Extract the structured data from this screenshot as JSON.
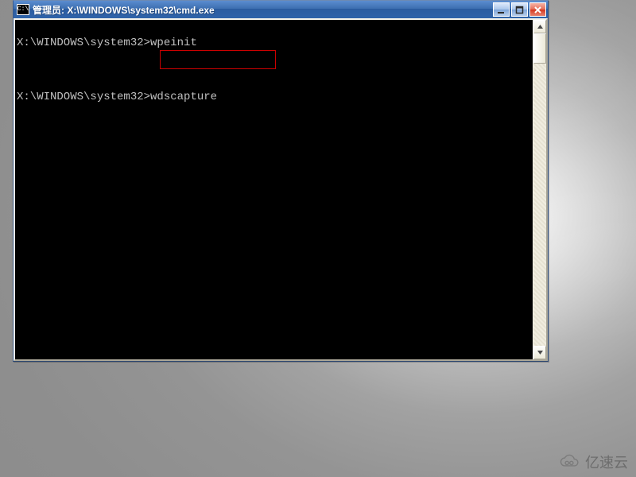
{
  "window": {
    "title": "管理员: X:\\WINDOWS\\system32\\cmd.exe",
    "icon_label": "C:\\"
  },
  "terminal": {
    "lines": [
      {
        "prompt": "X:\\WINDOWS\\system32>",
        "command": "wpeinit"
      },
      {
        "blank": true
      },
      {
        "prompt": "X:\\WINDOWS\\system32>",
        "command": "wdscapture",
        "highlighted": true
      }
    ]
  },
  "highlight": {
    "color": "#cc0000",
    "target_command": "wdscapture"
  },
  "controls": {
    "minimize": "Minimize",
    "maximize": "Maximize",
    "close": "Close",
    "scroll_up": "Scroll up",
    "scroll_down": "Scroll down"
  },
  "watermark": {
    "text": "亿速云"
  }
}
